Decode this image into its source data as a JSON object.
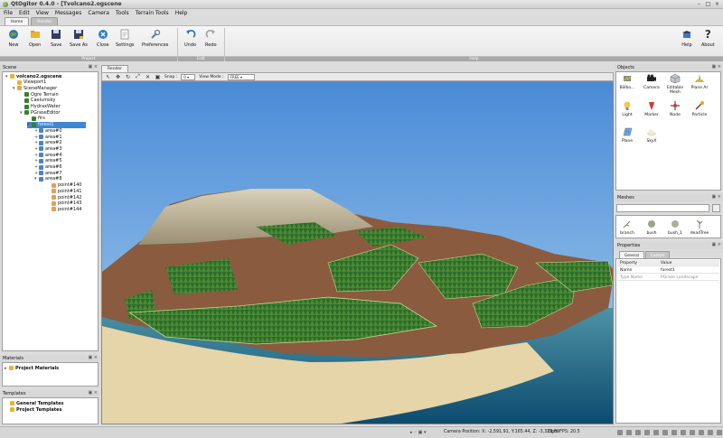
{
  "window": {
    "title": "QtOgitor 0.4.0 - [Tvolcano2.ogscene"
  },
  "menu": [
    "File",
    "Edit",
    "View",
    "Messages",
    "Camera",
    "Tools",
    "Terrain Tools",
    "Help"
  ],
  "ribbon_tabs": [
    "Home",
    "Render"
  ],
  "ribbon": {
    "buttons": {
      "new": "New",
      "open": "Open",
      "save": "Save",
      "save_as": "Save As",
      "close": "Close",
      "settings": "Settings",
      "preferences": "Preferences",
      "undo": "Undo",
      "redo": "Redo",
      "help": "Help",
      "about": "About"
    },
    "groups": {
      "project": "Project",
      "edit": "Edit",
      "help": "Help"
    }
  },
  "scene": {
    "title": "Scene",
    "items": [
      {
        "label": "volcano2.ogscene"
      },
      {
        "label": "Viewport1"
      },
      {
        "label": "SceneManager"
      },
      {
        "label": "Ogre Terrain"
      },
      {
        "label": "Caelumsky"
      },
      {
        "label": "HydraxWater"
      },
      {
        "label": "PGraseEditor"
      },
      {
        "label": "firs"
      },
      {
        "label": "forest1"
      },
      {
        "label": "area#0"
      },
      {
        "label": "area#1"
      },
      {
        "label": "area#2"
      },
      {
        "label": "area#3"
      },
      {
        "label": "area#4"
      },
      {
        "label": "area#5"
      },
      {
        "label": "area#6"
      },
      {
        "label": "area#7"
      },
      {
        "label": "area#8"
      },
      {
        "label": "point#140"
      },
      {
        "label": "point#141"
      },
      {
        "label": "point#142"
      },
      {
        "label": "point#143"
      },
      {
        "label": "point#144"
      }
    ]
  },
  "materials": {
    "title": "Materials",
    "items": [
      "Project Materials"
    ]
  },
  "templates": {
    "title": "Templates",
    "items": [
      "General Templates",
      "Project Templates"
    ]
  },
  "viewport": {
    "tab": "Render",
    "snap_label": "Snap :",
    "snap_value": "0",
    "view_mode_label": "View Mode :",
    "view_mode_value": "FREE"
  },
  "objects": {
    "title": "Objects",
    "items": [
      "Billbo...",
      "Camera",
      "Editable Mesh",
      "Plane Ar",
      "Light",
      "Marker",
      "Node",
      "Particle",
      "Plane",
      "SkyX"
    ]
  },
  "meshes": {
    "title": "Meshes",
    "items": [
      "branch",
      "bush",
      "bush_1",
      "deadTree"
    ]
  },
  "properties": {
    "title": "Properties",
    "tabs": [
      "General",
      "Custom"
    ],
    "headers": [
      "Property",
      "Value"
    ],
    "rows": [
      {
        "property": "Name",
        "value": "forest1"
      },
      {
        "property": "Type Name",
        "value": "PGrase Landscape"
      }
    ]
  },
  "status": {
    "camera": "Camera Position: X: -2,591.91, Y:165.44, Z: -3,326.89",
    "fps": "Ogre FPS: 20.5"
  }
}
